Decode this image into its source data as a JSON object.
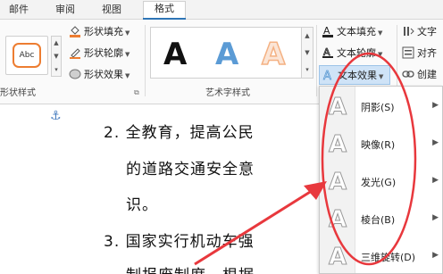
{
  "tabs": [
    {
      "label": "邮件"
    },
    {
      "label": "审阅"
    },
    {
      "label": "视图"
    },
    {
      "label": "格式",
      "active": true
    }
  ],
  "shape_styles": {
    "preview_text": "Abc",
    "fill_label": "形状填充",
    "outline_label": "形状轮廓",
    "effects_label": "形状效果",
    "group_label": "形状样式"
  },
  "wordart_styles": {
    "letters": [
      "A",
      "A",
      "A"
    ],
    "group_label": "艺术字样式"
  },
  "text_commands": {
    "fill_label": "文本填充",
    "outline_label": "文本轮廓",
    "effects_label": "文本效果"
  },
  "right_commands": {
    "text_direction_label": "文字",
    "align_label": "对齐",
    "link_label": "创建"
  },
  "document": {
    "lines": [
      "2. 全教育，提高公民",
      "的道路交通安全意",
      "识。",
      "3. 国家实行机动车强",
      "制报废制度，根据"
    ]
  },
  "effects_menu": {
    "items": [
      {
        "label": "阴影(S)"
      },
      {
        "label": "映像(R)"
      },
      {
        "label": "发光(G)"
      },
      {
        "label": "棱台(B)"
      },
      {
        "label": "三维旋转(D)"
      }
    ]
  },
  "colors": {
    "accent_red": "#e8383d",
    "wordart_blue": "#5b9bd5",
    "wordart_orange": "#f4b183",
    "outline_orange": "#ed7d31",
    "tab_underline": "#2e75b6"
  }
}
